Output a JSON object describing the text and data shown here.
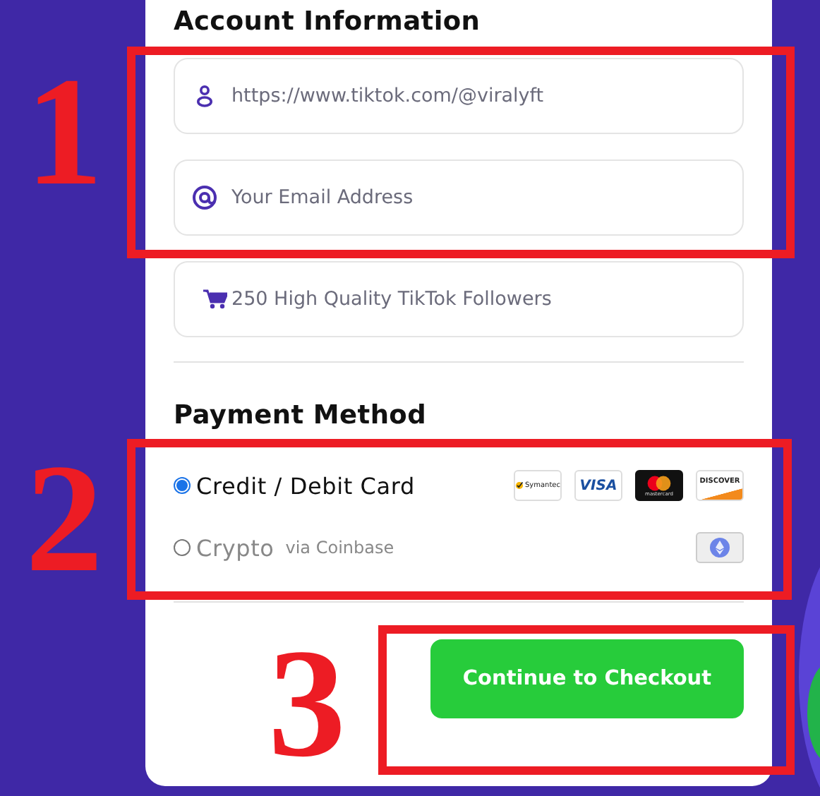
{
  "account": {
    "title": "Account Information",
    "fields": [
      {
        "kind": "profile",
        "value": "https://www.tiktok.com/@viralyft"
      },
      {
        "kind": "email",
        "placeholder": "Your Email Address"
      },
      {
        "kind": "product",
        "value": "250 High Quality TikTok Followers"
      }
    ]
  },
  "payment": {
    "title": "Payment Method",
    "options": [
      {
        "label": "Credit / Debit Card",
        "selected": true,
        "badges": [
          {
            "kind": "symantec",
            "text": "Symantec"
          },
          {
            "kind": "visa",
            "text": "VISA"
          },
          {
            "kind": "mastercard",
            "text": "mastercard"
          },
          {
            "kind": "discover",
            "text": "DISCOVER"
          }
        ]
      },
      {
        "label": "Crypto",
        "note": "via Coinbase",
        "selected": false,
        "badges": [
          {
            "kind": "ethereum"
          }
        ]
      }
    ]
  },
  "checkout_button": "Continue to Checkout",
  "annotations": [
    {
      "label": "1"
    },
    {
      "label": "2"
    },
    {
      "label": "3"
    }
  ]
}
